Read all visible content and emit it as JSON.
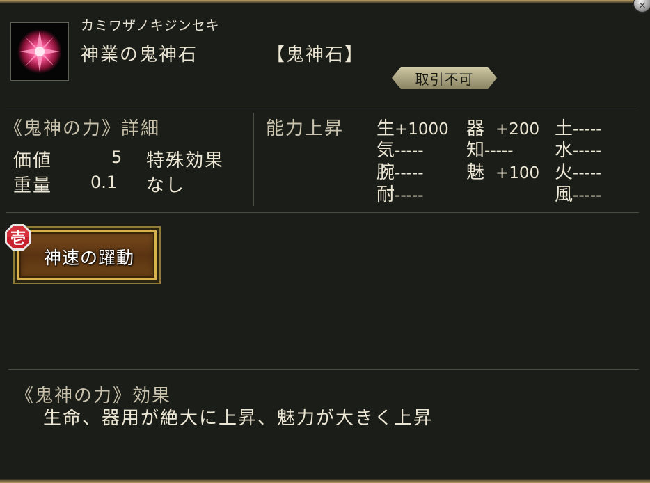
{
  "item": {
    "furigana": "カミワザノキジンセキ",
    "name": "神業の鬼神石",
    "category": "【鬼神石】",
    "trade_status": "取引不可"
  },
  "details": {
    "section_title": "《鬼神の力》詳細",
    "value_label": "価値",
    "value": "5",
    "weight_label": "重量",
    "weight": "0.1",
    "special_effect_label": "特殊効果",
    "special_effect_value": "なし"
  },
  "ability": {
    "title": "能力上昇",
    "stats": [
      {
        "name": "生",
        "value": "+1000"
      },
      {
        "name": "器",
        "value": "+200"
      },
      {
        "name": "土",
        "value": "-----"
      },
      {
        "name": "気",
        "value": "-----"
      },
      {
        "name": "知",
        "value": "-----"
      },
      {
        "name": "水",
        "value": "-----"
      },
      {
        "name": "腕",
        "value": "-----"
      },
      {
        "name": "魅",
        "value": "+100"
      },
      {
        "name": "火",
        "value": "-----"
      },
      {
        "name": "耐",
        "value": "-----"
      },
      {
        "name": "風",
        "value": "-----"
      }
    ]
  },
  "skill": {
    "rank": "壱",
    "label": "神速の躍動"
  },
  "effect": {
    "title": "《鬼神の力》効果",
    "description": "生命、器用が絶大に上昇、魅力が大きく上昇"
  },
  "colors": {
    "background": "#1b1d18",
    "text": "#ece6d4",
    "skill_gold": "#d8b24a",
    "rank_red": "#c8202c"
  }
}
